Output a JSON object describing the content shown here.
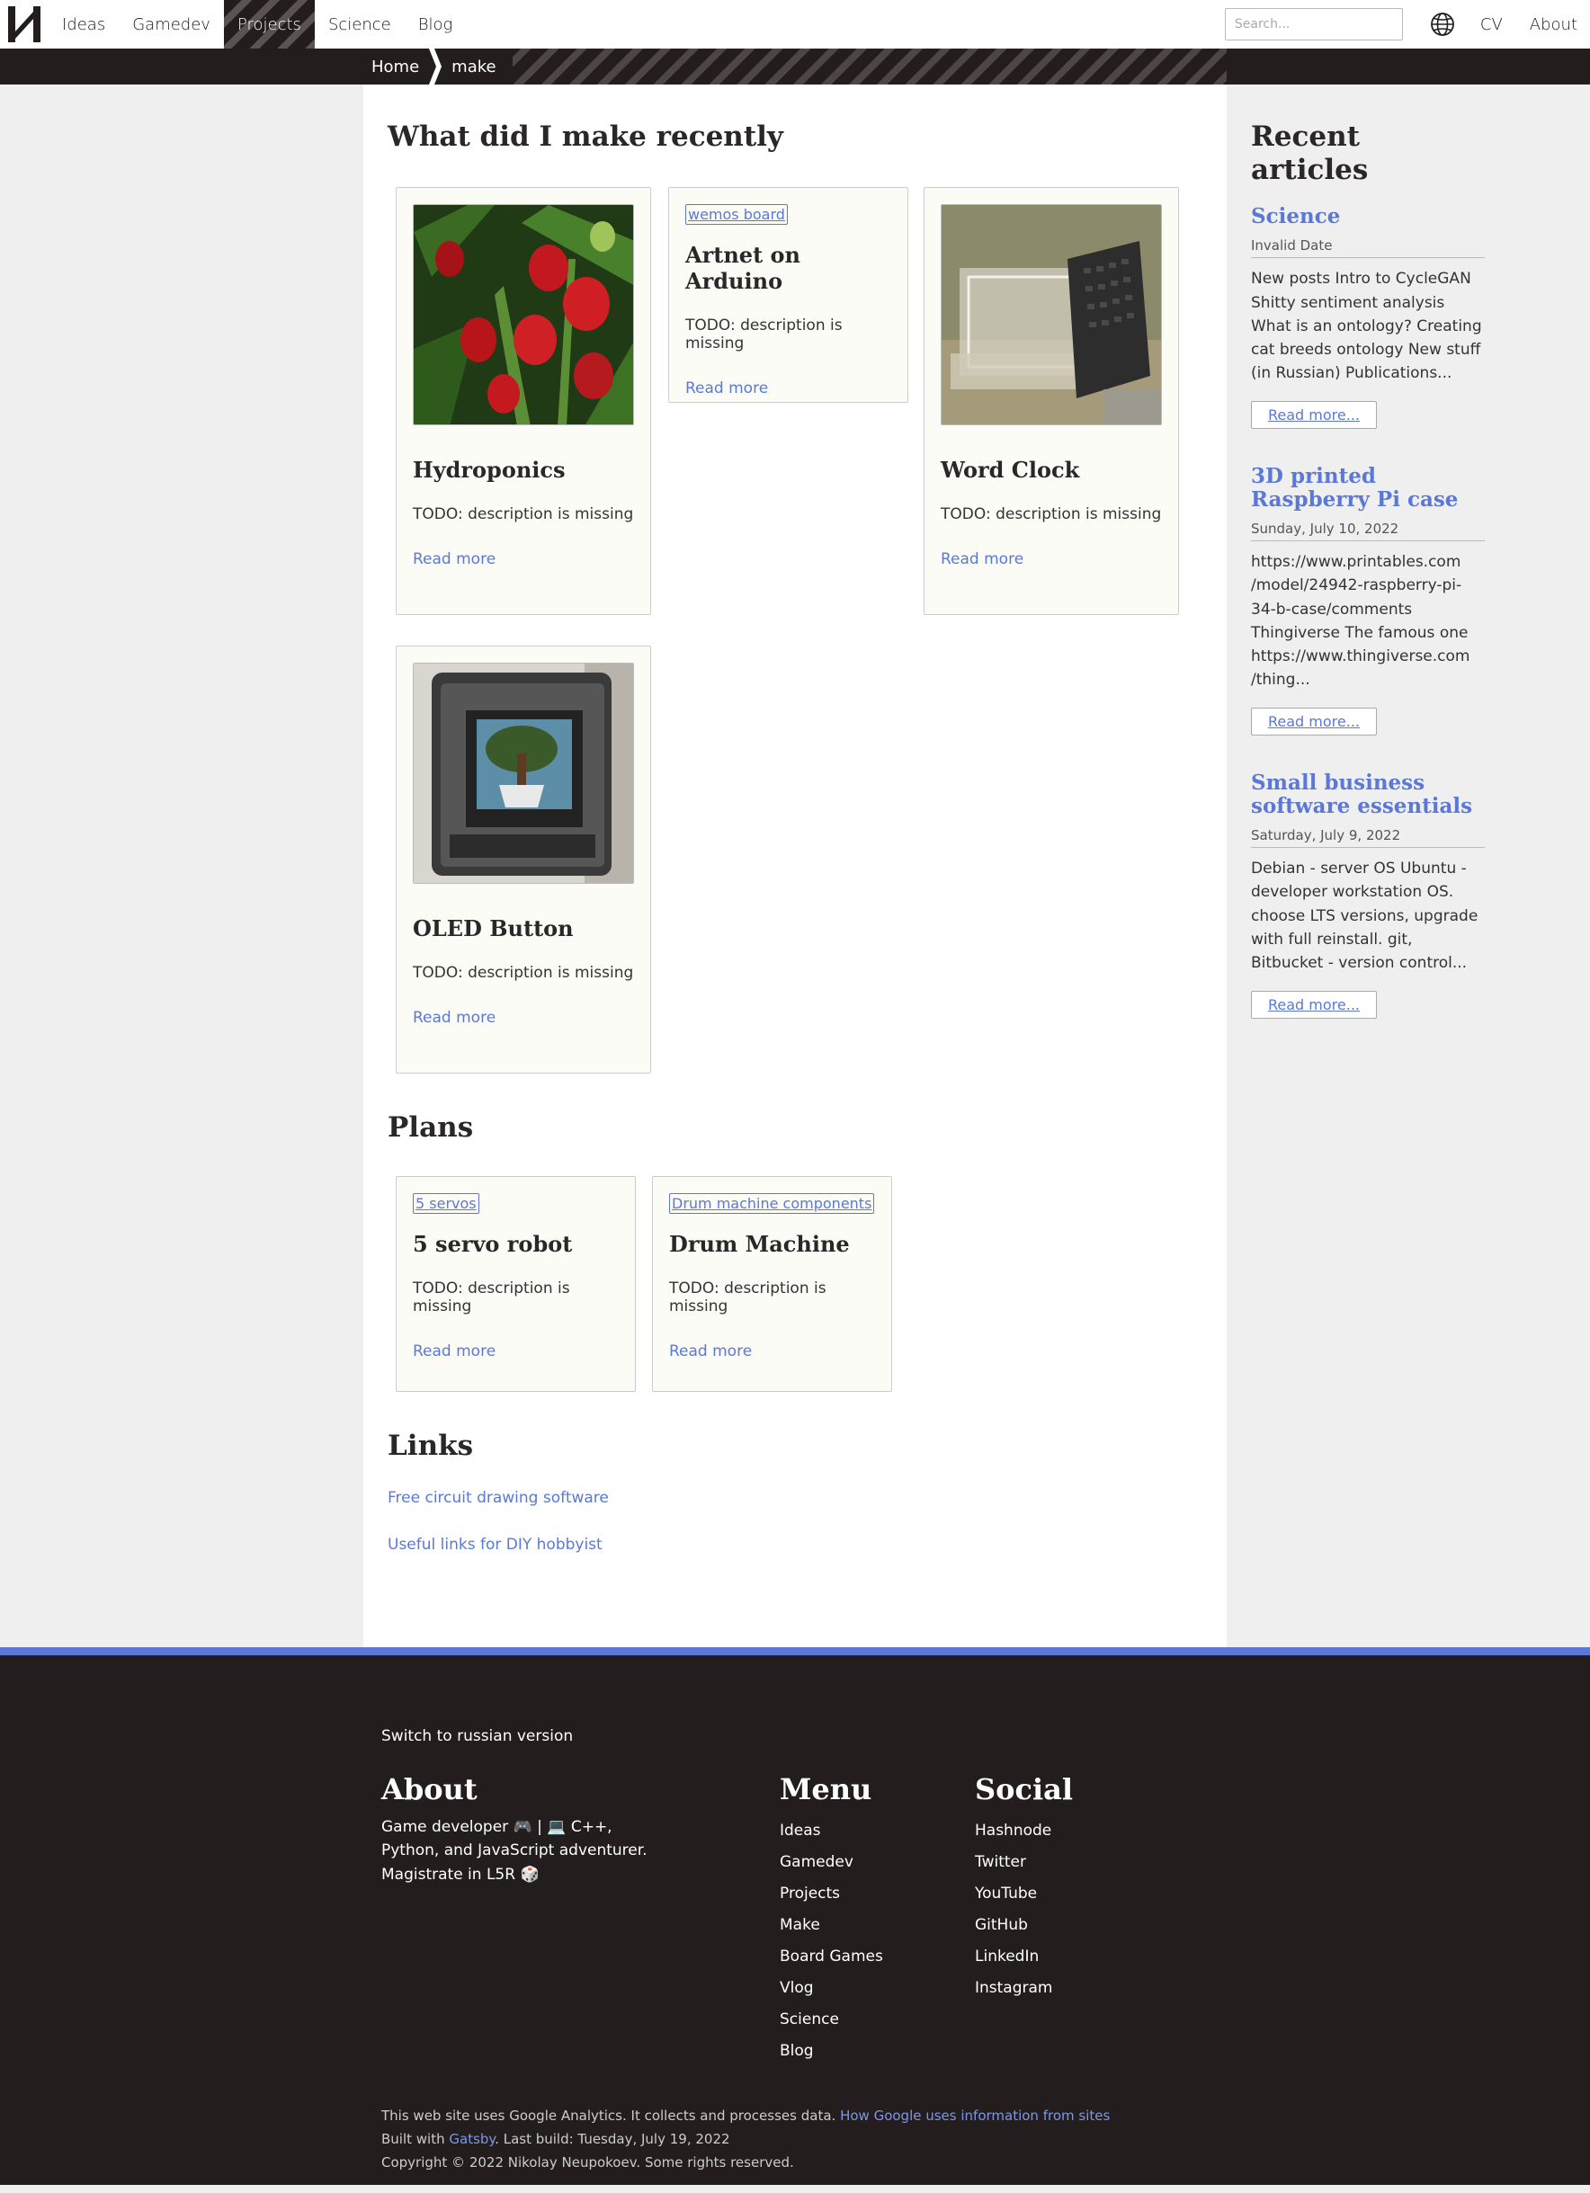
{
  "nav": {
    "items": [
      "Ideas",
      "Gamedev",
      "Projects",
      "Science",
      "Blog"
    ],
    "active": "Projects",
    "search_placeholder": "Search...",
    "cv": "CV",
    "about": "About"
  },
  "breadcrumb": [
    "Home",
    "make"
  ],
  "main": {
    "recent_title": "What did I make recently",
    "cards": [
      {
        "title": "Hydroponics",
        "desc": "TODO: description is missing",
        "read": "Read more"
      },
      {
        "tag": "wemos board",
        "title": "Artnet on Arduino",
        "desc": "TODO: description is missing",
        "read": "Read more"
      },
      {
        "title": "Word Clock",
        "desc": "TODO: description is missing",
        "read": "Read more"
      },
      {
        "title": "OLED Button",
        "desc": "TODO: description is missing",
        "read": "Read more"
      }
    ],
    "plans_title": "Plans",
    "plans": [
      {
        "tag": "5 servos",
        "title": "5 servo robot",
        "desc": "TODO: description is missing",
        "read": "Read more"
      },
      {
        "tag": "Drum machine components",
        "title": "Drum Machine",
        "desc": "TODO: description is missing",
        "read": "Read more"
      }
    ],
    "links_title": "Links",
    "links": [
      "Free circuit drawing software",
      "Useful links for DIY hobbyist"
    ]
  },
  "aside": {
    "title": "Recent articles",
    "articles": [
      {
        "title": "Science",
        "date": "Invalid Date",
        "body": "New posts Intro to CycleGAN Shitty sentiment analysis What is an ontology? Creating cat breeds ontology New stuff (in Russian) Publications...",
        "btn": "Read more..."
      },
      {
        "title": "3D printed Raspberry Pi case",
        "date": "Sunday, July 10, 2022",
        "body": "https://www.printables.com /model/24942-raspberry-pi-34-b-case/comments Thingiverse The famous one https://www.thingiverse.com /thing...",
        "btn": "Read more..."
      },
      {
        "title": "Small business software essentials",
        "date": "Saturday, July 9, 2022",
        "body": "Debian - server OS Ubuntu - developer workstation OS. choose LTS versions, upgrade with full reinstall. git, Bitbucket - version control...",
        "btn": "Read more..."
      }
    ]
  },
  "footer": {
    "switch": "Switch to russian version",
    "about_title": "About",
    "about_text": "Game developer 🎮 | 💻 C++, Python, and JavaScript adventurer. Magistrate in L5R 🎲",
    "menu_title": "Menu",
    "menu": [
      "Ideas",
      "Gamedev",
      "Projects",
      "Make",
      "Board Games",
      "Vlog",
      "Science",
      "Blog"
    ],
    "social_title": "Social",
    "social": [
      "Hashnode",
      "Twitter",
      "YouTube",
      "GitHub",
      "LinkedIn",
      "Instagram"
    ],
    "analytics_text": "This web site uses Google Analytics. It collects and processes data.",
    "analytics_link": "How Google uses information from sites",
    "built_prefix": "Built with",
    "built_link": "Gatsby",
    "built_suffix": ". Last build: Tuesday, July 19, 2022",
    "copyright": "Copyright © 2022 Nikolay Neupokoev. Some rights reserved."
  }
}
